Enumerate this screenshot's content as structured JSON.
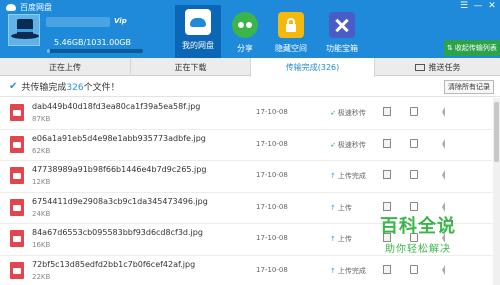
{
  "app": {
    "title": "百度网盘"
  },
  "user": {
    "vip_badge": "Vip",
    "storage": "5.46GB/1031.00GB",
    "storage_fraction": 0.0053
  },
  "nav": [
    {
      "label": "我的网盘"
    },
    {
      "label": "分享"
    },
    {
      "label": "隐藏空间"
    },
    {
      "label": "功能宝箱"
    }
  ],
  "window_controls": {
    "settings": "☰",
    "minimize": "—",
    "close": "✕"
  },
  "upload_button": {
    "label": "收起传输列表"
  },
  "tabs": [
    {
      "label": "正在上传"
    },
    {
      "label": "正在下载"
    },
    {
      "label": "传输完成(326)"
    },
    {
      "label": "推送任务"
    }
  ],
  "summary": {
    "prefix": "共传输完成",
    "count": "326",
    "suffix": "个文件！",
    "clear_label": "清除所有记录"
  },
  "files": [
    {
      "name": "dab449b40d18fd3ea80ca1f39a5ea58f.jpg",
      "size": "87KB",
      "date": "17-10-08",
      "status": "极速秒传",
      "fast": true
    },
    {
      "name": "e06a1a91eb5d4e98e1abb935773adbfe.jpg",
      "size": "62KB",
      "date": "17-10-08",
      "status": "极速秒传",
      "fast": true
    },
    {
      "name": "47738989a91b98f66b1446e4b7d9c265.jpg",
      "size": "12KB",
      "date": "17-10-08",
      "status": "上传完成",
      "fast": false
    },
    {
      "name": "6754411d9e2908a3cb9c1da345473496.jpg",
      "size": "24KB",
      "date": "17-10-08",
      "status": "上传",
      "fast": false
    },
    {
      "name": "84a67d6553cb095583bbf93d6cd8cf3d.jpg",
      "size": "16KB",
      "date": "17-10-08",
      "status": "上传",
      "fast": false
    },
    {
      "name": "72bf5c13d85edfd2bb1c7b0f6cef42af.jpg",
      "size": "22KB",
      "date": "17-10-08",
      "status": "上传完成",
      "fast": false
    }
  ],
  "watermark": {
    "title": "百科全说",
    "subtitle": "助你轻松解决"
  },
  "colors": {
    "header": "#1f8ad9",
    "active_nav": "#0b66b5",
    "accent": "#2b8ede",
    "upload": "#2da24d",
    "file_icon": "#e2454e"
  }
}
